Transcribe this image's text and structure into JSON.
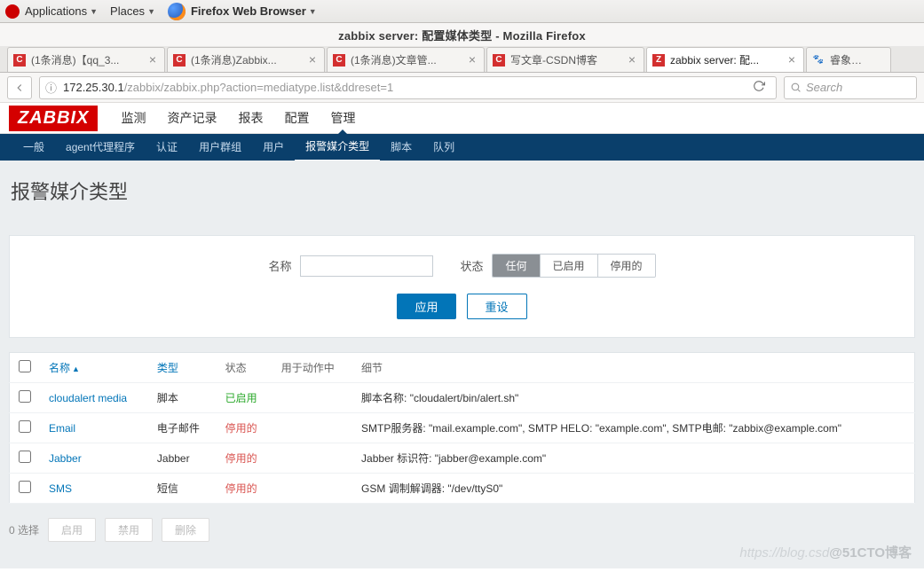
{
  "gnome": {
    "applications": "Applications",
    "places": "Places",
    "browser": "Firefox Web Browser"
  },
  "window_title": "zabbix server: 配置媒体类型 - Mozilla Firefox",
  "tabs": [
    {
      "label": "(1条消息)【qq_3...",
      "fav": "C"
    },
    {
      "label": "(1条消息)Zabbix...",
      "fav": "C"
    },
    {
      "label": "(1条消息)文章管...",
      "fav": "C"
    },
    {
      "label": "写文章-CSDN博客",
      "fav": "C"
    },
    {
      "label": "zabbix server: 配...",
      "fav": "Z",
      "active": true
    },
    {
      "label": "睿象云_百...",
      "fav": "paw",
      "partial": true
    }
  ],
  "url": {
    "host": "172.25.30.1",
    "path": "/zabbix/zabbix.php?action=mediatype.list&ddreset=1"
  },
  "search_placeholder": "Search",
  "zabbix": {
    "logo": "ZABBIX",
    "nav1": [
      "监测",
      "资产记录",
      "报表",
      "配置",
      "管理"
    ],
    "nav1_active": 4,
    "nav2": [
      "一般",
      "agent代理程序",
      "认证",
      "用户群组",
      "用户",
      "报警媒介类型",
      "脚本",
      "队列"
    ],
    "nav2_active": 5,
    "page_title": "报警媒介类型",
    "filter": {
      "name_label": "名称",
      "status_label": "状态",
      "seg": [
        "任何",
        "已启用",
        "停用的"
      ],
      "seg_active": 0,
      "apply": "应用",
      "reset": "重设"
    },
    "columns": {
      "name": "名称",
      "type": "类型",
      "status": "状态",
      "used_in": "用于动作中",
      "details": "细节"
    },
    "rows": [
      {
        "name": "cloudalert media",
        "type": "脚本",
        "status": "已启用",
        "status_class": "green",
        "details": "脚本名称: \"cloudalert/bin/alert.sh\""
      },
      {
        "name": "Email",
        "type": "电子邮件",
        "status": "停用的",
        "status_class": "red",
        "details": "SMTP服务器: \"mail.example.com\", SMTP HELO: \"example.com\", SMTP电邮: \"zabbix@example.com\""
      },
      {
        "name": "Jabber",
        "type": "Jabber",
        "status": "停用的",
        "status_class": "red",
        "details": "Jabber 标识符: \"jabber@example.com\""
      },
      {
        "name": "SMS",
        "type": "短信",
        "status": "停用的",
        "status_class": "red",
        "details": "GSM 调制解调器: \"/dev/ttyS0\""
      }
    ],
    "footer": {
      "selected": "0 选择",
      "enable": "启用",
      "disable": "禁用",
      "delete": "删除"
    }
  },
  "watermark": {
    "a": "https://blog.csd",
    "b": "@51CTO博客"
  }
}
